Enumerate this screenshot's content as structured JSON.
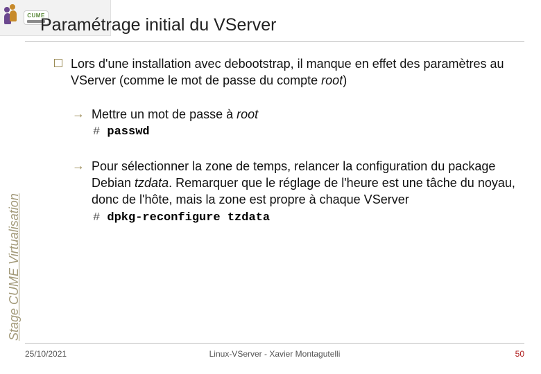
{
  "logo": {
    "label": "CUME"
  },
  "title": "Paramétrage initial du VServer",
  "bullet1": {
    "prefix": "Lors d'une installation avec debootstrap, il manque en effet des paramètres au VServer (comme le mot de passe du compte ",
    "italic": "root",
    "suffix": ")"
  },
  "sub1": {
    "prefix": "Mettre un mot de passe à ",
    "italic": "root"
  },
  "code1": {
    "hash": "#",
    "cmd": " passwd"
  },
  "sub2": {
    "part1": "Pour sélectionner la zone de temps, relancer la configuration du package Debian ",
    "italic1": "tzdata",
    "part2": ". Remarquer que le réglage de l'heure est une tâche du noyau, donc de l'hôte, mais la zone est propre à chaque VServer"
  },
  "code2": {
    "hash": "#",
    "cmd": " dpkg-reconfigure tzdata"
  },
  "side_label": "Stage CUME Virtualisation",
  "footer": {
    "date": "25/10/2021",
    "center": "Linux-VServer - Xavier Montagutelli",
    "page": "50"
  }
}
